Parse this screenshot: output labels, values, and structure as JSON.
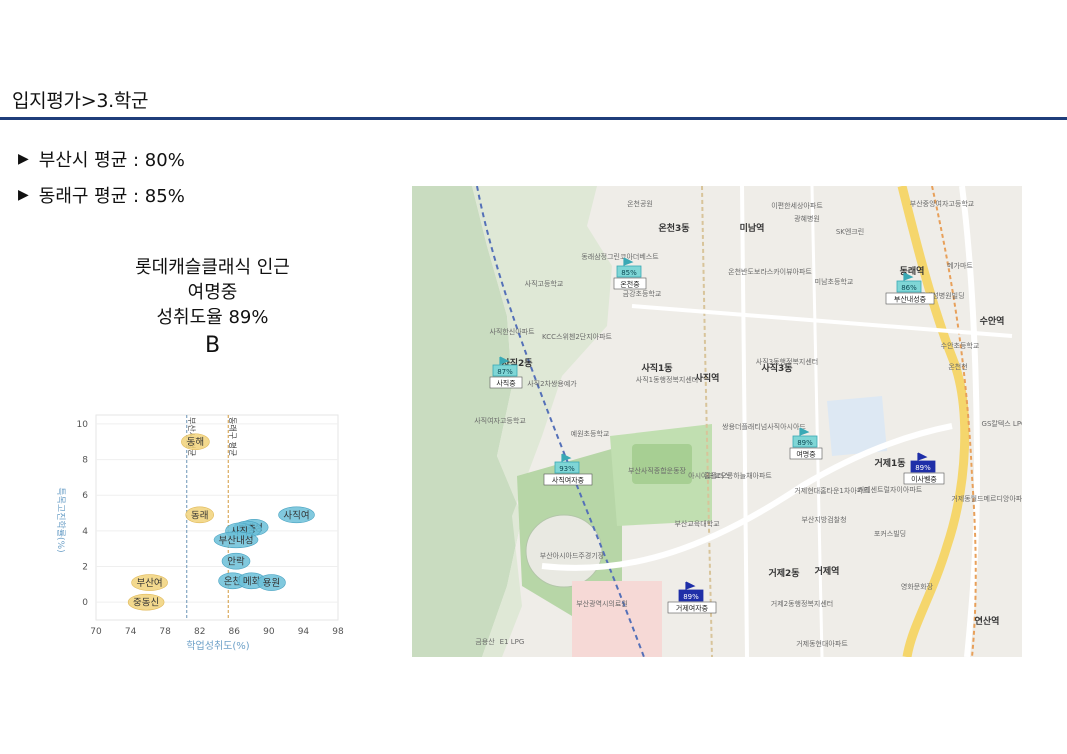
{
  "header": {
    "title": "입지평가>3.학군"
  },
  "stats": [
    {
      "marker": "▶",
      "label": "부산시 평균 : 80%"
    },
    {
      "marker": "▶",
      "label": "동래구 평균 : 85%"
    }
  ],
  "annotation": {
    "line1": "롯데캐슬클래식 인근",
    "line2": "여명중",
    "line3": "성취도율 89%",
    "grade": "B"
  },
  "chart_data": {
    "type": "scatter",
    "xlabel": "학업성취도(%)",
    "ylabel": "특목고진학률(%)",
    "xlim": [
      70,
      98
    ],
    "ylim": [
      -1,
      10.5
    ],
    "x_ticks": [
      70,
      74,
      78,
      82,
      86,
      90,
      94,
      98
    ],
    "y_ticks": [
      0,
      2,
      4,
      6,
      8,
      10
    ],
    "reference_lines": [
      {
        "label": "부산시 평균",
        "x": 80.5,
        "color": "#6a93b5"
      },
      {
        "label": "동래구 평균",
        "x": 85.3,
        "color": "#d29a3c"
      }
    ],
    "points": [
      {
        "label": "동해",
        "x": 81.5,
        "y": 9.0,
        "group": "yellow"
      },
      {
        "label": "동래",
        "x": 82.0,
        "y": 4.9,
        "group": "yellow"
      },
      {
        "label": "부산여",
        "x": 76.2,
        "y": 1.1,
        "group": "yellow"
      },
      {
        "label": "중동신",
        "x": 75.8,
        "y": 0.0,
        "group": "yellow"
      },
      {
        "label": "사직여",
        "x": 93.2,
        "y": 4.9,
        "group": "blue"
      },
      {
        "label": "내성",
        "x": 88.3,
        "y": 4.2,
        "group": "blue"
      },
      {
        "label": "명중",
        "x": 87.5,
        "y": 4.1,
        "group": "blue"
      },
      {
        "label": "사직",
        "x": 86.6,
        "y": 4.0,
        "group": "blue"
      },
      {
        "label": "부산내성",
        "x": 86.2,
        "y": 3.5,
        "group": "blue"
      },
      {
        "label": "안락",
        "x": 86.2,
        "y": 2.3,
        "group": "blue"
      },
      {
        "label": "온천",
        "x": 85.8,
        "y": 1.2,
        "group": "blue"
      },
      {
        "label": "메화",
        "x": 88.0,
        "y": 1.2,
        "group": "blue"
      },
      {
        "label": "용원",
        "x": 90.3,
        "y": 1.1,
        "group": "blue"
      }
    ]
  },
  "map": {
    "markers": [
      {
        "pct": "85%",
        "name": "온천중"
      },
      {
        "pct": "87%",
        "name": "사직중"
      },
      {
        "pct": "93%",
        "name": "사직여자중"
      },
      {
        "pct": "89%",
        "name": "여명중"
      },
      {
        "pct": "86%",
        "name": "부산내성중"
      },
      {
        "pct": "89%",
        "name": "이사벨중"
      },
      {
        "pct": "89%",
        "name": "거제여자중"
      }
    ],
    "labels": [
      {
        "text": "온천3동"
      },
      {
        "text": "미남역"
      },
      {
        "text": "동래역"
      },
      {
        "text": "수안역"
      },
      {
        "text": "사직2동"
      },
      {
        "text": "사직1동"
      },
      {
        "text": "사직3동"
      },
      {
        "text": "사직역"
      },
      {
        "text": "거제1동"
      },
      {
        "text": "거제2동"
      },
      {
        "text": "거제역"
      },
      {
        "text": "연산역"
      },
      {
        "text": "온천공원"
      },
      {
        "text": "광혜병원"
      },
      {
        "text": "SK엔크린"
      },
      {
        "text": "사직고등학교"
      },
      {
        "text": "금강초등학교"
      },
      {
        "text": "미남초등학교"
      },
      {
        "text": "사직여자고등학교"
      },
      {
        "text": "예원초등학교"
      },
      {
        "text": "부산사직종합운동장"
      },
      {
        "text": "홈플러스"
      },
      {
        "text": "부산교육대학교"
      },
      {
        "text": "부산지방검찰청"
      },
      {
        "text": "포커스빌딩"
      },
      {
        "text": "영화문화장"
      },
      {
        "text": "E1 LPG"
      },
      {
        "text": "부산광역시의료원"
      },
      {
        "text": "수안초등학교"
      },
      {
        "text": "GS칼텍스 LPG"
      },
      {
        "text": "부산아시아드주경기장"
      },
      {
        "text": "아시아드코오롱하늘채아파트"
      },
      {
        "text": "거제센트럴자이아파트"
      },
      {
        "text": "거제동월드메르디앙아파트"
      },
      {
        "text": "거제현대홈타운1차아파트"
      },
      {
        "text": "거제2동행정복지센터"
      },
      {
        "text": "사직1동행정복지센터"
      },
      {
        "text": "사직3동행정복지센터"
      },
      {
        "text": "쌍용더플래티넘사직아시아드"
      },
      {
        "text": "온천반도보라스카이뷰아파트"
      },
      {
        "text": "동래삼정그린코아더베스트"
      },
      {
        "text": "사직한신아파트"
      },
      {
        "text": "KCC스위첸2단지아파트"
      },
      {
        "text": "사직2차쌍용예가"
      },
      {
        "text": "부산중앙여자고등학교"
      },
      {
        "text": "동래성병원빌딩"
      },
      {
        "text": "거제동현대아파트"
      },
      {
        "text": "금용산"
      },
      {
        "text": "메가마트"
      },
      {
        "text": "온천천"
      },
      {
        "text": "이편한세상아파트"
      }
    ]
  }
}
